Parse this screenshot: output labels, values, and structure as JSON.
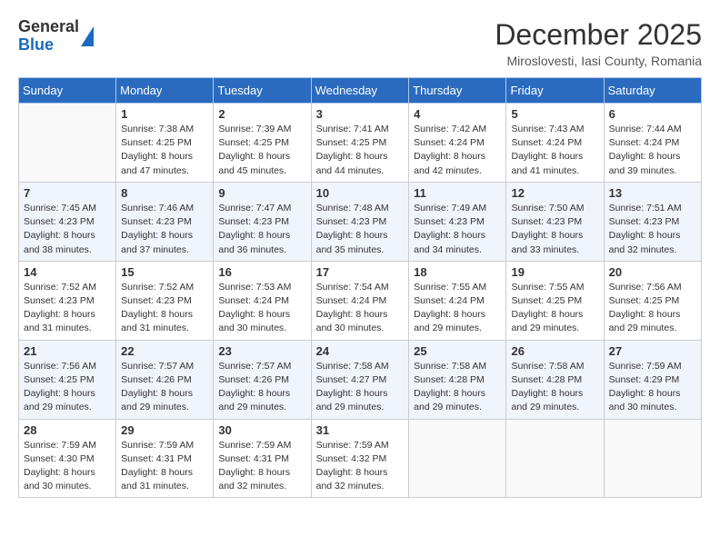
{
  "header": {
    "logo_general": "General",
    "logo_blue": "Blue",
    "month_year": "December 2025",
    "location": "Miroslovesti, Iasi County, Romania"
  },
  "weekdays": [
    "Sunday",
    "Monday",
    "Tuesday",
    "Wednesday",
    "Thursday",
    "Friday",
    "Saturday"
  ],
  "rows": [
    [
      {
        "day": "",
        "info": ""
      },
      {
        "day": "1",
        "info": "Sunrise: 7:38 AM\nSunset: 4:25 PM\nDaylight: 8 hours\nand 47 minutes."
      },
      {
        "day": "2",
        "info": "Sunrise: 7:39 AM\nSunset: 4:25 PM\nDaylight: 8 hours\nand 45 minutes."
      },
      {
        "day": "3",
        "info": "Sunrise: 7:41 AM\nSunset: 4:25 PM\nDaylight: 8 hours\nand 44 minutes."
      },
      {
        "day": "4",
        "info": "Sunrise: 7:42 AM\nSunset: 4:24 PM\nDaylight: 8 hours\nand 42 minutes."
      },
      {
        "day": "5",
        "info": "Sunrise: 7:43 AM\nSunset: 4:24 PM\nDaylight: 8 hours\nand 41 minutes."
      },
      {
        "day": "6",
        "info": "Sunrise: 7:44 AM\nSunset: 4:24 PM\nDaylight: 8 hours\nand 39 minutes."
      }
    ],
    [
      {
        "day": "7",
        "info": "Sunrise: 7:45 AM\nSunset: 4:23 PM\nDaylight: 8 hours\nand 38 minutes."
      },
      {
        "day": "8",
        "info": "Sunrise: 7:46 AM\nSunset: 4:23 PM\nDaylight: 8 hours\nand 37 minutes."
      },
      {
        "day": "9",
        "info": "Sunrise: 7:47 AM\nSunset: 4:23 PM\nDaylight: 8 hours\nand 36 minutes."
      },
      {
        "day": "10",
        "info": "Sunrise: 7:48 AM\nSunset: 4:23 PM\nDaylight: 8 hours\nand 35 minutes."
      },
      {
        "day": "11",
        "info": "Sunrise: 7:49 AM\nSunset: 4:23 PM\nDaylight: 8 hours\nand 34 minutes."
      },
      {
        "day": "12",
        "info": "Sunrise: 7:50 AM\nSunset: 4:23 PM\nDaylight: 8 hours\nand 33 minutes."
      },
      {
        "day": "13",
        "info": "Sunrise: 7:51 AM\nSunset: 4:23 PM\nDaylight: 8 hours\nand 32 minutes."
      }
    ],
    [
      {
        "day": "14",
        "info": "Sunrise: 7:52 AM\nSunset: 4:23 PM\nDaylight: 8 hours\nand 31 minutes."
      },
      {
        "day": "15",
        "info": "Sunrise: 7:52 AM\nSunset: 4:23 PM\nDaylight: 8 hours\nand 31 minutes."
      },
      {
        "day": "16",
        "info": "Sunrise: 7:53 AM\nSunset: 4:24 PM\nDaylight: 8 hours\nand 30 minutes."
      },
      {
        "day": "17",
        "info": "Sunrise: 7:54 AM\nSunset: 4:24 PM\nDaylight: 8 hours\nand 30 minutes."
      },
      {
        "day": "18",
        "info": "Sunrise: 7:55 AM\nSunset: 4:24 PM\nDaylight: 8 hours\nand 29 minutes."
      },
      {
        "day": "19",
        "info": "Sunrise: 7:55 AM\nSunset: 4:25 PM\nDaylight: 8 hours\nand 29 minutes."
      },
      {
        "day": "20",
        "info": "Sunrise: 7:56 AM\nSunset: 4:25 PM\nDaylight: 8 hours\nand 29 minutes."
      }
    ],
    [
      {
        "day": "21",
        "info": "Sunrise: 7:56 AM\nSunset: 4:25 PM\nDaylight: 8 hours\nand 29 minutes."
      },
      {
        "day": "22",
        "info": "Sunrise: 7:57 AM\nSunset: 4:26 PM\nDaylight: 8 hours\nand 29 minutes."
      },
      {
        "day": "23",
        "info": "Sunrise: 7:57 AM\nSunset: 4:26 PM\nDaylight: 8 hours\nand 29 minutes."
      },
      {
        "day": "24",
        "info": "Sunrise: 7:58 AM\nSunset: 4:27 PM\nDaylight: 8 hours\nand 29 minutes."
      },
      {
        "day": "25",
        "info": "Sunrise: 7:58 AM\nSunset: 4:28 PM\nDaylight: 8 hours\nand 29 minutes."
      },
      {
        "day": "26",
        "info": "Sunrise: 7:58 AM\nSunset: 4:28 PM\nDaylight: 8 hours\nand 29 minutes."
      },
      {
        "day": "27",
        "info": "Sunrise: 7:59 AM\nSunset: 4:29 PM\nDaylight: 8 hours\nand 30 minutes."
      }
    ],
    [
      {
        "day": "28",
        "info": "Sunrise: 7:59 AM\nSunset: 4:30 PM\nDaylight: 8 hours\nand 30 minutes."
      },
      {
        "day": "29",
        "info": "Sunrise: 7:59 AM\nSunset: 4:31 PM\nDaylight: 8 hours\nand 31 minutes."
      },
      {
        "day": "30",
        "info": "Sunrise: 7:59 AM\nSunset: 4:31 PM\nDaylight: 8 hours\nand 32 minutes."
      },
      {
        "day": "31",
        "info": "Sunrise: 7:59 AM\nSunset: 4:32 PM\nDaylight: 8 hours\nand 32 minutes."
      },
      {
        "day": "",
        "info": ""
      },
      {
        "day": "",
        "info": ""
      },
      {
        "day": "",
        "info": ""
      }
    ]
  ]
}
